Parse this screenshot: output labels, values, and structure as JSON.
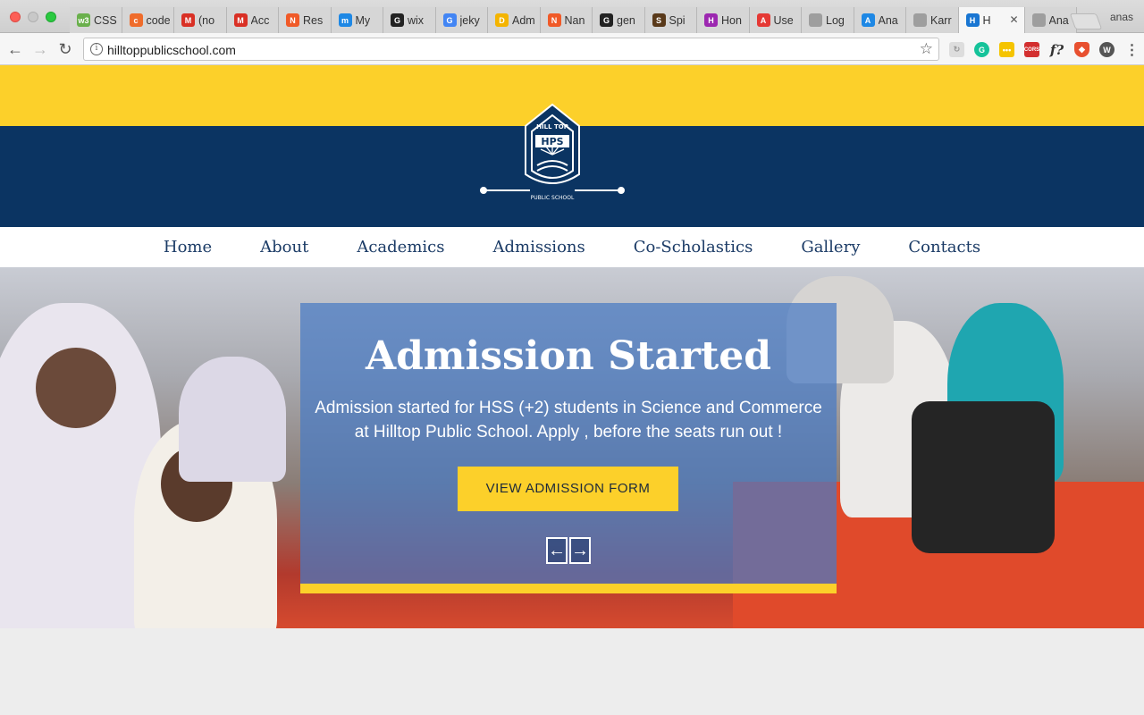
{
  "browser": {
    "tabs": [
      {
        "title": "CSS",
        "favicon_color": "#6ab04c",
        "favicon_text": "w3"
      },
      {
        "title": "code",
        "favicon_color": "#ef6c2b",
        "favicon_text": "c"
      },
      {
        "title": "(no",
        "favicon_color": "#d93025",
        "favicon_text": "M"
      },
      {
        "title": "Acc",
        "favicon_color": "#d93025",
        "favicon_text": "M"
      },
      {
        "title": "Res",
        "favicon_color": "#f05a28",
        "favicon_text": "N"
      },
      {
        "title": "My",
        "favicon_color": "#1e88e5",
        "favicon_text": "m"
      },
      {
        "title": "wix",
        "favicon_color": "#222222",
        "favicon_text": "G"
      },
      {
        "title": "jeky",
        "favicon_color": "#4285f4",
        "favicon_text": "G"
      },
      {
        "title": "Adm",
        "favicon_color": "#f4b400",
        "favicon_text": "D"
      },
      {
        "title": "Nan",
        "favicon_color": "#f05a28",
        "favicon_text": "N"
      },
      {
        "title": "gen",
        "favicon_color": "#222222",
        "favicon_text": "G"
      },
      {
        "title": "Spi",
        "favicon_color": "#5a3a1a",
        "favicon_text": "S"
      },
      {
        "title": "Hon",
        "favicon_color": "#9c27b0",
        "favicon_text": "H"
      },
      {
        "title": "Use",
        "favicon_color": "#e53935",
        "favicon_text": "A"
      },
      {
        "title": "Log",
        "favicon_color": "#9e9e9e",
        "favicon_text": ""
      },
      {
        "title": "Ana",
        "favicon_color": "#1e88e5",
        "favicon_text": "A"
      },
      {
        "title": "Karr",
        "favicon_color": "#9e9e9e",
        "favicon_text": ""
      },
      {
        "title": "H",
        "favicon_color": "#1976d2",
        "favicon_text": "H",
        "active": true
      },
      {
        "title": "Ana",
        "favicon_color": "#9e9e9e",
        "favicon_text": ""
      }
    ],
    "profile_name": "anas",
    "url": "hilltoppublicschool.com"
  },
  "site": {
    "logo": {
      "top_text": "HILL TOP",
      "initials": "HPS",
      "bottom_text": "PUBLIC SCHOOL"
    },
    "menu": [
      "Home",
      "About",
      "Academics",
      "Admissions",
      "Co-Scholastics",
      "Gallery",
      "Contacts"
    ],
    "hero": {
      "title": "Admission Started",
      "text": "Admission started for HSS (+2) students in Science and Commerce at Hilltop Public School. Apply , before the seats run out !",
      "cta_label": "VIEW ADMISSION FORM",
      "prev_label": "←",
      "next_label": "→"
    },
    "colors": {
      "yellow": "#fcd02a",
      "navy": "#0b3462",
      "menu_text": "#1b3b66",
      "overlay": "#487ac4"
    }
  }
}
